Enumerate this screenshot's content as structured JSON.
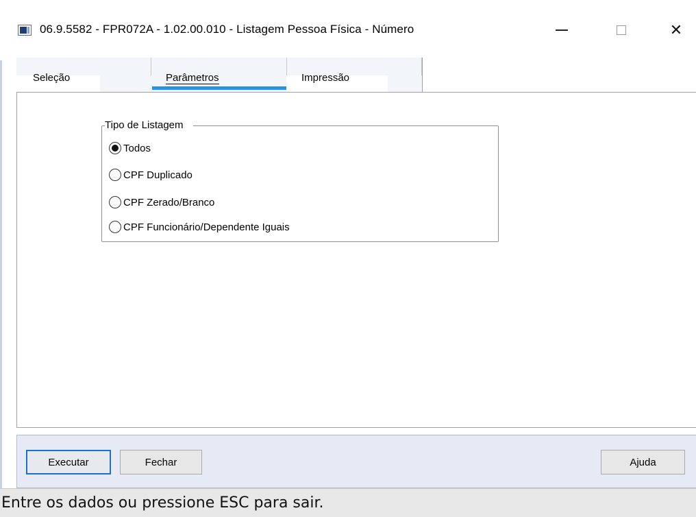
{
  "window": {
    "title": "06.9.5582 - FPR072A - 1.02.00.010 - Listagem Pessoa Física - Número",
    "icon": "app-window-icon"
  },
  "tabs": [
    {
      "label": "Seleção",
      "selected": false
    },
    {
      "label": "Parâmetros",
      "selected": true
    },
    {
      "label": "Impressão",
      "selected": false
    }
  ],
  "groupbox": {
    "legend": "Tipo de Listagem",
    "options": [
      {
        "label": "Todos",
        "checked": true
      },
      {
        "label": "CPF Duplicado",
        "checked": false
      },
      {
        "label": "CPF Zerado/Branco",
        "checked": false
      },
      {
        "label": "CPF Funcionário/Dependente Iguais",
        "checked": false
      }
    ]
  },
  "buttons": {
    "execute": "Executar",
    "close": "Fechar",
    "help": "Ajuda"
  },
  "status": {
    "message": "Entre os dados ou pressione ESC para sair."
  },
  "colors": {
    "tab_active_underline": "#2f8fd8",
    "default_button_border": "#1d6fc9",
    "button_bar_bg": "#e6eaf4"
  }
}
